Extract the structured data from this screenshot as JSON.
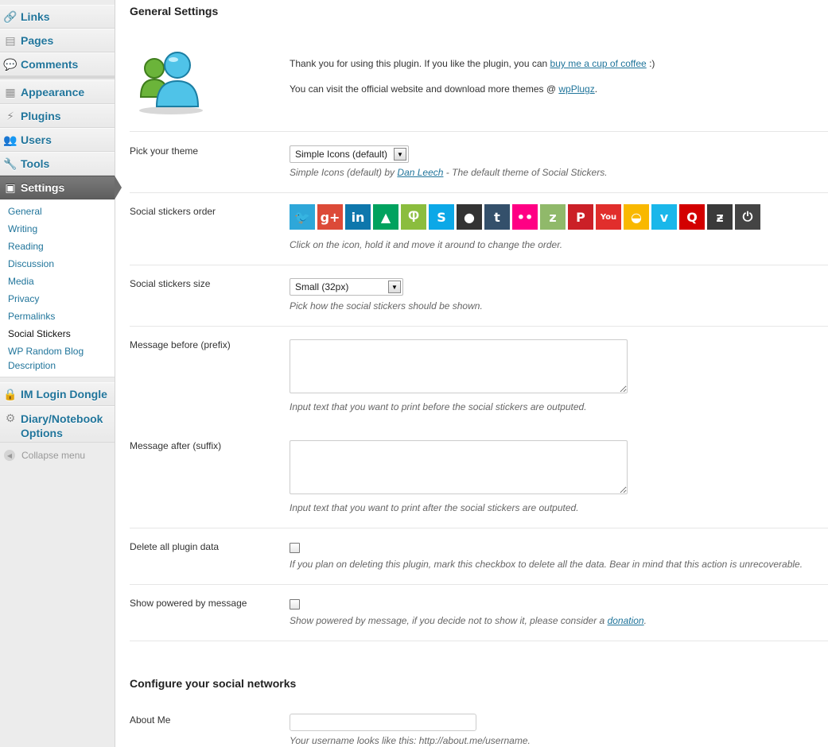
{
  "sidebar": {
    "items": [
      {
        "label": "Links",
        "icon": "links-icon",
        "glyph": "🔗"
      },
      {
        "label": "Pages",
        "icon": "pages-icon",
        "glyph": "▤"
      },
      {
        "label": "Comments",
        "icon": "comments-icon",
        "glyph": "💬"
      },
      {
        "label": "Appearance",
        "icon": "appearance-icon",
        "glyph": "▦"
      },
      {
        "label": "Plugins",
        "icon": "plugins-icon",
        "glyph": "⚡"
      },
      {
        "label": "Users",
        "icon": "users-icon",
        "glyph": "👥"
      },
      {
        "label": "Tools",
        "icon": "tools-icon",
        "glyph": "🔧"
      },
      {
        "label": "Settings",
        "icon": "settings-icon",
        "glyph": "▣"
      },
      {
        "label": "IM Login Dongle",
        "icon": "lock-icon",
        "glyph": "🔒"
      },
      {
        "label": "Diary/Notebook",
        "label2": "Options",
        "icon": "gear-icon",
        "glyph": "⚙"
      }
    ],
    "submenu": [
      "General",
      "Writing",
      "Reading",
      "Discussion",
      "Media",
      "Privacy",
      "Permalinks",
      "Social Stickers",
      "WP Random Blog",
      "Description"
    ],
    "collapse_label": "Collapse menu"
  },
  "main": {
    "general_title": "General Settings",
    "thanks_text": "Thank you for using this plugin. If you like the plugin, you can ",
    "thanks_link": "buy me a cup of coffee",
    "thanks_tail": " :)",
    "visit_text": "You can visit the official website and download more themes @ ",
    "visit_link": "wpPlugz",
    "visit_tail": ".",
    "theme": {
      "label": "Pick your theme",
      "value": "Simple Icons (default)",
      "desc_pre": "Simple Icons (default) by ",
      "desc_link": "Dan Leech",
      "desc_post": " - The default theme of Social Stickers."
    },
    "order": {
      "label": "Social stickers order",
      "desc": "Click on the icon, hold it and move it around to change the order."
    },
    "size": {
      "label": "Social stickers size",
      "value": "Small (32px)",
      "desc": "Pick how the social stickers should be shown."
    },
    "prefix": {
      "label": "Message before (prefix)",
      "desc": "Input text that you want to print before the social stickers are outputed.",
      "value": ""
    },
    "suffix": {
      "label": "Message after (suffix)",
      "desc": "Input text that you want to print after the social stickers are outputed.",
      "value": ""
    },
    "delete": {
      "label": "Delete all plugin data",
      "desc": "If you plan on deleting this plugin, mark this checkbox to delete all the data. Bear in mind that this action is unrecoverable.",
      "checked": false
    },
    "powered": {
      "label": "Show powered by message",
      "desc_pre": "Show powered by message, if you decide not to show it, please consider a ",
      "desc_link": "donation",
      "desc_post": ".",
      "checked": false
    },
    "networks_title": "Configure your social networks",
    "aboutme": {
      "label": "About Me",
      "value": "",
      "desc": "Your username looks like this: http://about.me/username."
    }
  },
  "stickers": [
    {
      "name": "twitter-sticker-icon",
      "glyph": "🐦",
      "color": "#2ea7d9"
    },
    {
      "name": "googleplus-sticker-icon",
      "glyph": "g+",
      "color": "#dc4a38"
    },
    {
      "name": "linkedin-sticker-icon",
      "glyph": "in",
      "color": "#0e77ac"
    },
    {
      "name": "pinboard-sticker-icon",
      "glyph": "▲",
      "color": "#00a25f"
    },
    {
      "name": "meetup-sticker-icon",
      "glyph": "Ⴔ",
      "color": "#8bbd3e"
    },
    {
      "name": "skype-sticker-icon",
      "glyph": "S",
      "color": "#0ca8e7"
    },
    {
      "name": "github-sticker-icon",
      "glyph": "●",
      "color": "#333333"
    },
    {
      "name": "tumblr-sticker-icon",
      "glyph": "t",
      "color": "#34506b"
    },
    {
      "name": "flickr-sticker-icon",
      "glyph": "••",
      "color": "#ff0084"
    },
    {
      "name": "zerply-sticker-icon",
      "glyph": "z",
      "color": "#90b96a"
    },
    {
      "name": "pinterest-sticker-icon",
      "glyph": "P",
      "color": "#cb2027"
    },
    {
      "name": "youtube-sticker-icon",
      "glyph": "You",
      "color": "#e12e2c"
    },
    {
      "name": "grooveshark-sticker-icon",
      "glyph": "◒",
      "color": "#f9b800"
    },
    {
      "name": "vimeo-sticker-icon",
      "glyph": "v",
      "color": "#1ab7ea"
    },
    {
      "name": "quora-sticker-icon",
      "glyph": "Q",
      "color": "#d30000"
    },
    {
      "name": "zootool-sticker-icon",
      "glyph": "ƶ",
      "color": "#3a3a3a"
    },
    {
      "name": "power-sticker-icon",
      "glyph": "⏻",
      "color": "#444444"
    }
  ]
}
